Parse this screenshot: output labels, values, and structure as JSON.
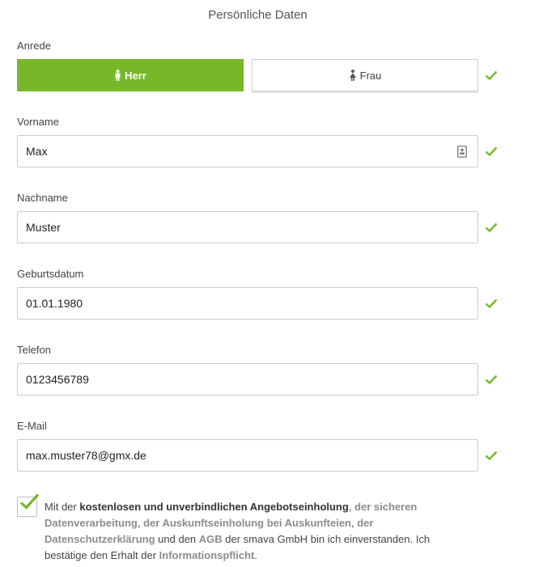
{
  "section_title": "Persönliche Daten",
  "salutation": {
    "label": "Anrede",
    "options": [
      {
        "label": "Herr",
        "selected": true
      },
      {
        "label": "Frau",
        "selected": false
      }
    ]
  },
  "fields": {
    "first_name": {
      "label": "Vorname",
      "value": "Max"
    },
    "last_name": {
      "label": "Nachname",
      "value": "Muster"
    },
    "birthdate": {
      "label": "Geburtsdatum",
      "value": "01.01.1980"
    },
    "phone": {
      "label": "Telefon",
      "value": "0123456789"
    },
    "email": {
      "label": "E-Mail",
      "value": "max.muster78@gmx.de"
    }
  },
  "consent": {
    "checked": true,
    "t1": "Mit der ",
    "b1": "kostenlosen und unverbindlichen Angebotseinholung",
    "t2": ", ",
    "l1": "der sicheren Datenverarbeitung",
    "t3": ", ",
    "l2": "der Auskunftseinholung bei Auskunfteien",
    "t4": ", ",
    "l3": "der Datenschutzerklärung",
    "t5": " und den ",
    "l4": "AGB",
    "t6": " der smava GmbH bin ich einverstanden. Ich bestätige den Erhalt der ",
    "l5": "Informationspflicht",
    "t7": "."
  },
  "colors": {
    "accent": "#76b82a",
    "link": "#8c8c8c",
    "border": "#cccccc"
  },
  "icons": {
    "male": "male-icon",
    "female": "female-icon",
    "contact_card": "contact-card-icon",
    "valid": "checkmark-icon"
  }
}
